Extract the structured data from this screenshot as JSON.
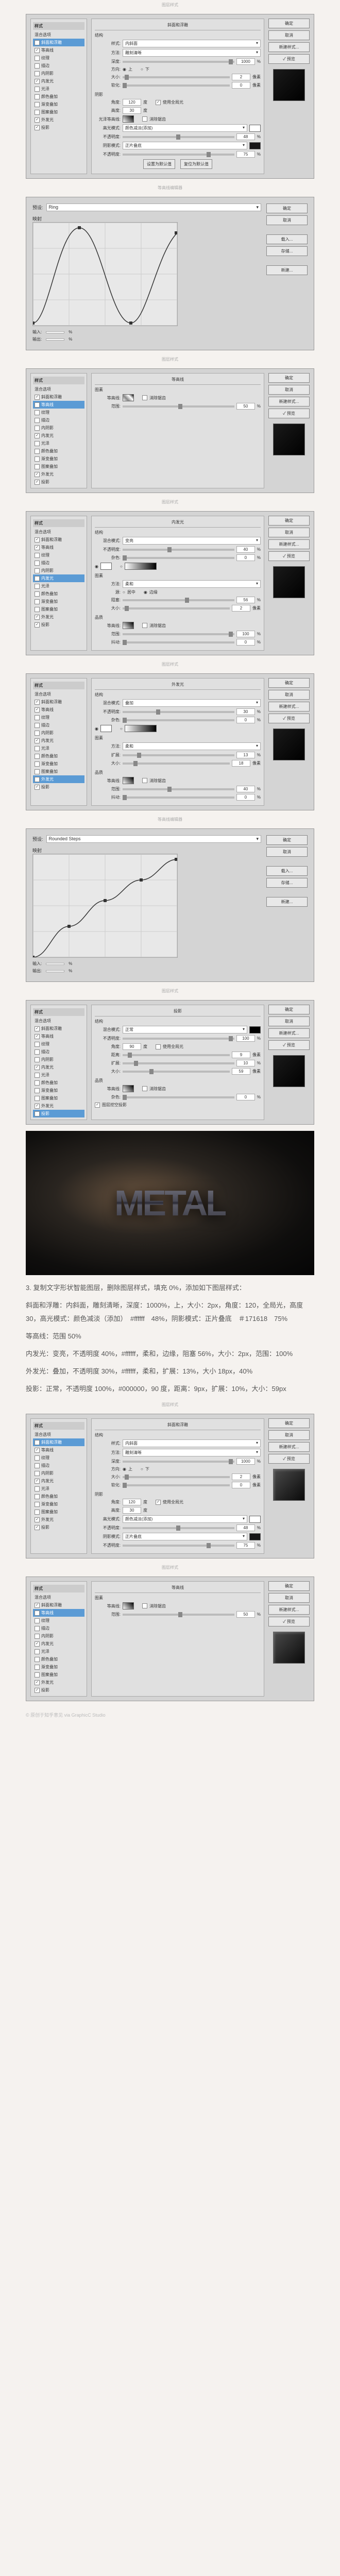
{
  "captions": {
    "layerStyle": "图层样式",
    "curveEditor": "等高线编辑器"
  },
  "leftPanel": {
    "header1": "样式",
    "header2": "混合选项",
    "items": [
      "斜面和浮雕",
      "等高线",
      "纹理",
      "描边",
      "内阴影",
      "内发光",
      "光泽",
      "颜色叠加",
      "渐变叠加",
      "图案叠加",
      "外发光",
      "投影"
    ]
  },
  "rightBtns": {
    "ok": "确定",
    "cancel": "取消",
    "new": "新建样式...",
    "preview": "✓ 预览"
  },
  "curve1": {
    "title": "等高线编辑器",
    "presetLabel": "预设:",
    "preset": "Ring",
    "mapping": "映射",
    "input": "输入:",
    "output": "输出:",
    "pct": "%",
    "ok": "确定",
    "cancel": "取消",
    "load": "载入...",
    "save": "存储...",
    "new": "新建..."
  },
  "curve2": {
    "preset": "Rounded Steps"
  },
  "dialog1": {
    "title": "斜面和浮雕",
    "structHeader": "结构",
    "styleLabel": "样式:",
    "style": "内斜面",
    "techLabel": "方法:",
    "tech": "雕刻清晰",
    "depthLabel": "深度:",
    "depth": "1000",
    "pct": "%",
    "dirLabel": "方向:",
    "dirUp": "上",
    "dirDown": "下",
    "sizeLabel": "大小:",
    "size": "2",
    "px": "像素",
    "softenLabel": "软化:",
    "soften": "0",
    "shadeHeader": "阴影",
    "angleLabel": "角度:",
    "angle": "120",
    "deg": "度",
    "globalLight": "使用全局光",
    "altLabel": "高度:",
    "alt": "30",
    "glossLabel": "光泽等高线:",
    "antiAlias": "消除锯齿",
    "hiModeLabel": "高光模式:",
    "hiMode": "颜色减淡(添加)",
    "hiOpLabel": "不透明度:",
    "hiOp": "48",
    "shModeLabel": "阴影模式:",
    "shMode": "正片叠底",
    "shOpLabel": "不透明度:",
    "shOp": "75",
    "reset": "设置为默认值",
    "default": "复位为默认值"
  },
  "dialog2": {
    "title": "等高线",
    "elemHeader": "图素",
    "contourLabel": "等高线:",
    "antiAlias": "消除锯齿",
    "rangeLabel": "范围:",
    "range": "50",
    "pct": "%"
  },
  "dialog3": {
    "title": "内发光",
    "structHeader": "结构",
    "blendLabel": "混合模式:",
    "blend": "变亮",
    "opLabel": "不透明度:",
    "op": "40",
    "pct": "%",
    "noiseLabel": "杂色:",
    "noise": "0",
    "elemHeader": "图素",
    "techLabel": "方法:",
    "tech": "柔和",
    "srcLabel": "源:",
    "srcCenter": "居中",
    "srcEdge": "边缘",
    "chokeLabel": "阻塞:",
    "choke": "56",
    "sizeLabel": "大小:",
    "size": "2",
    "px": "像素",
    "qualHeader": "品质",
    "contourLabel": "等高线:",
    "antiAlias": "消除锯齿",
    "rangeLabel": "范围:",
    "range": "100",
    "jitterLabel": "抖动:",
    "jitter": "0"
  },
  "dialog4": {
    "title": "外发光",
    "blend": "叠加",
    "op": "30",
    "noise": "0",
    "tech": "柔和",
    "spreadLabel": "扩展:",
    "spread": "13",
    "size": "18",
    "range": "40",
    "jitter": "0"
  },
  "dialog5": {
    "title": "投影",
    "blend": "正常",
    "op": "100",
    "angleLabel": "角度:",
    "angle": "90",
    "deg": "度",
    "globalLight": "使用全局光",
    "distLabel": "距离:",
    "dist": "9",
    "px": "像素",
    "spreadLabel": "扩展:",
    "spread": "10",
    "pct": "%",
    "sizeLabel": "大小:",
    "size": "59",
    "contourLabel": "等高线:",
    "antiAlias": "消除锯齿",
    "noiseLabel": "杂色:",
    "noise": "0",
    "knockout": "图层挖空投影"
  },
  "hero": "METAL",
  "text": {
    "p1": "3. 复制文字形状智能图层，删除图层样式，填充 0%，添加如下图层样式：",
    "p2": "斜面和浮雕：内斜面，雕刻清晰，深度：1000%，上，大小：2px，角度：120，全局光，高度 30，高光模式：颜色减淡（添加）　#ffffff　48%，阴影模式：正片叠底　＃171618　75%",
    "p3": "等高线：范围 50%",
    "p4": "内发光：变亮，不透明度 40%，#ffffff，柔和，边缘，阻塞 56%，大小：2px，范围：100%",
    "p5": "外发光：叠加，不透明度 30%，#ffffff，柔和，扩展：13%，大小 18px，40%",
    "p6": "投影：正常，不透明度 100%，#000000，90 度，距离：9px，扩展：10%，大小：59px"
  },
  "footer": "© 原创于知乎意见 via GraphicC Studio"
}
